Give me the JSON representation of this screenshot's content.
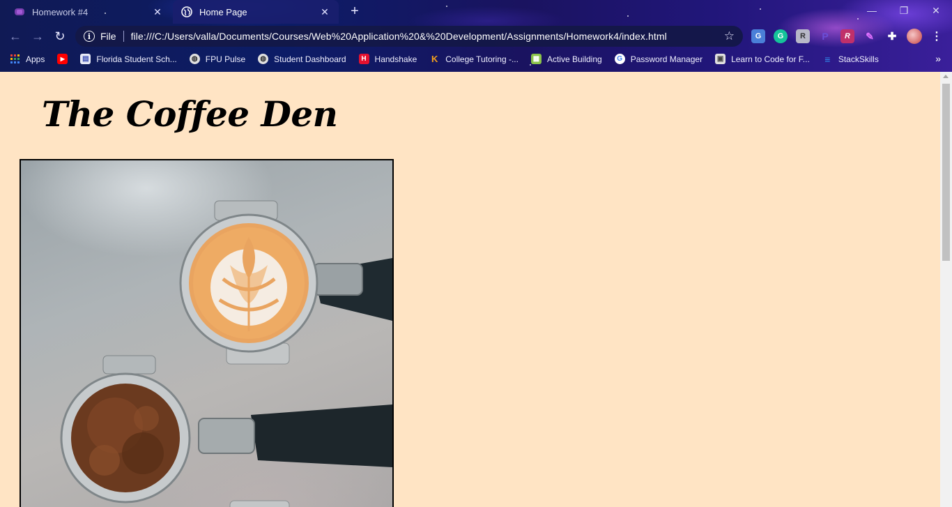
{
  "browser": {
    "tabs": [
      {
        "title": "Homework #4",
        "active": false,
        "icon": "homework-favicon"
      },
      {
        "title": "Home Page",
        "active": true,
        "icon": "globe-icon"
      }
    ],
    "new_tab_glyph": "+",
    "close_glyph": "✕",
    "window_controls": {
      "minimize": "—",
      "restore": "❐",
      "close": "✕"
    },
    "omnibox": {
      "info_glyph": "i",
      "scheme_label": "File",
      "url": "file:///C:/Users/valla/Documents/Courses/Web%20Application%20&%20Development/Assignments/Homework4/index.html",
      "star_glyph": "☆"
    },
    "nav": {
      "back": "←",
      "forward": "→",
      "reload": "↻"
    },
    "extensions": [
      {
        "name": "translate-extension-icon",
        "glyph": "G",
        "color": "#4a7fd8"
      },
      {
        "name": "grammarly-extension-icon",
        "glyph": "G",
        "color": "#15c39a"
      },
      {
        "name": "reader-extension-icon",
        "glyph": "R",
        "color": "#b8b8c8"
      },
      {
        "name": "p-extension-icon",
        "glyph": "P",
        "color": "#6a4fd8"
      },
      {
        "name": "r-extension-icon",
        "glyph": "R",
        "color": "#c0306a"
      },
      {
        "name": "color-extension-icon",
        "glyph": "✎",
        "color": "#8a50e0"
      },
      {
        "name": "puzzle-extension-icon",
        "glyph": "✚",
        "color": "transparent"
      }
    ],
    "menu_glyph": "⋮",
    "bookmarks": [
      {
        "label": "Apps",
        "icon": "apps-grid-icon",
        "color": "#ea4335"
      },
      {
        "label": "",
        "icon": "youtube-icon",
        "color": "#ff0000"
      },
      {
        "label": "Florida Student Sch...",
        "icon": "document-icon",
        "color": "#e8eaf6"
      },
      {
        "label": "FPU Pulse",
        "icon": "globe-icon",
        "color": "#e0e0e0"
      },
      {
        "label": "Student Dashboard",
        "icon": "globe-icon",
        "color": "#e0e0e0"
      },
      {
        "label": "Handshake",
        "icon": "handshake-icon",
        "color": "#e5112f"
      },
      {
        "label": "College Tutoring -...",
        "icon": "tutoring-icon",
        "color": "#f7a21b"
      },
      {
        "label": "Active Building",
        "icon": "building-icon",
        "color": "#8bc34a"
      },
      {
        "label": "Password Manager",
        "icon": "google-icon",
        "color": "#ffffff"
      },
      {
        "label": "Learn to Code for F...",
        "icon": "calendar-icon",
        "color": "#e0e0e0"
      },
      {
        "label": "StackSkills",
        "icon": "stackskills-icon",
        "color": "#2e8ef0"
      }
    ],
    "bookmarks_overflow": "»"
  },
  "page": {
    "title": "The Coffee Den",
    "background_color": "#ffe4c4",
    "hero_image_alt": "Two espresso portafilters with latte art and ground coffee"
  }
}
